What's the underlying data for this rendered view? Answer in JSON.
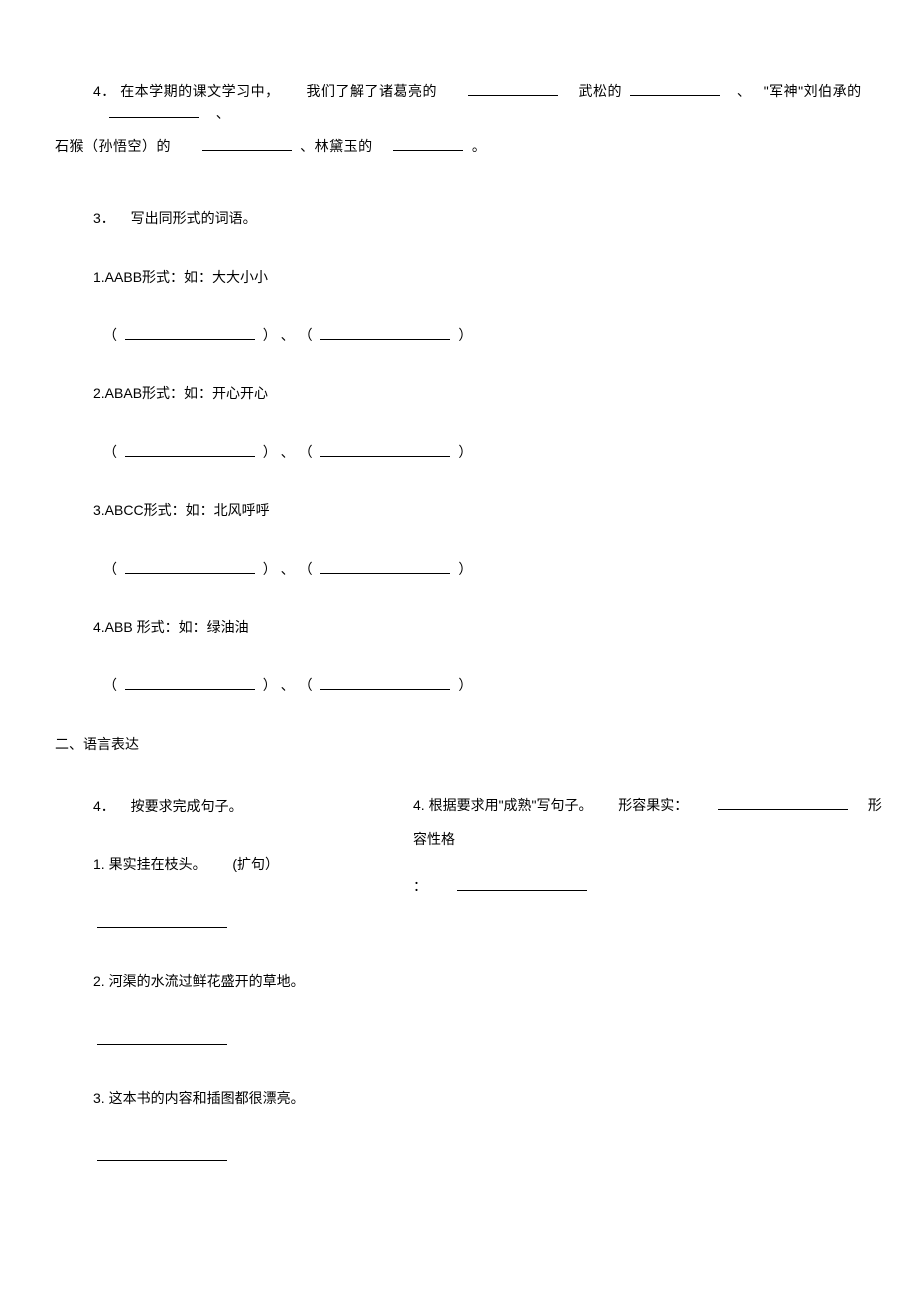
{
  "q4_intro": {
    "prefix": "4．",
    "text1": "在本学期的课文学习中，",
    "text2": "我们了解了诸葛亮的",
    "text3": "武松的",
    "text4": "、",
    "text5": "\"军神\"刘伯承的",
    "text6": "、",
    "line2_prefix": "石猴（孙悟空）的",
    "line2_sep": "、林黛玉的",
    "line2_end": "。"
  },
  "q3": {
    "prefix": "3．",
    "title": "写出同形式的词语。",
    "item1_label": "1.AABB形式：如：大大小小",
    "item2_label": "2.ABAB形式：如：开心开心",
    "item3_label": "3.ABCC形式：如：北风呼呼",
    "item4_label": "4.ABB 形式：如：绿油油",
    "paren_open": "（",
    "paren_close": "）",
    "sep": "、"
  },
  "section2": {
    "heading": "二、语言表达"
  },
  "q4b": {
    "prefix": "4．",
    "title": "按要求完成句子。",
    "s1": "1. 果实挂在枝头。",
    "s1_note": "(扩句）",
    "s2": "2. 河渠的水流过鲜花盛开的草地。",
    "s3": "3. 这本书的内容和插图都很漂亮。",
    "s4_prefix": "4. 根据要求用\"成熟\"写句子。",
    "s4_label1": "形容果实：",
    "s4_label2": "形容性格",
    "s4_colon": "："
  }
}
